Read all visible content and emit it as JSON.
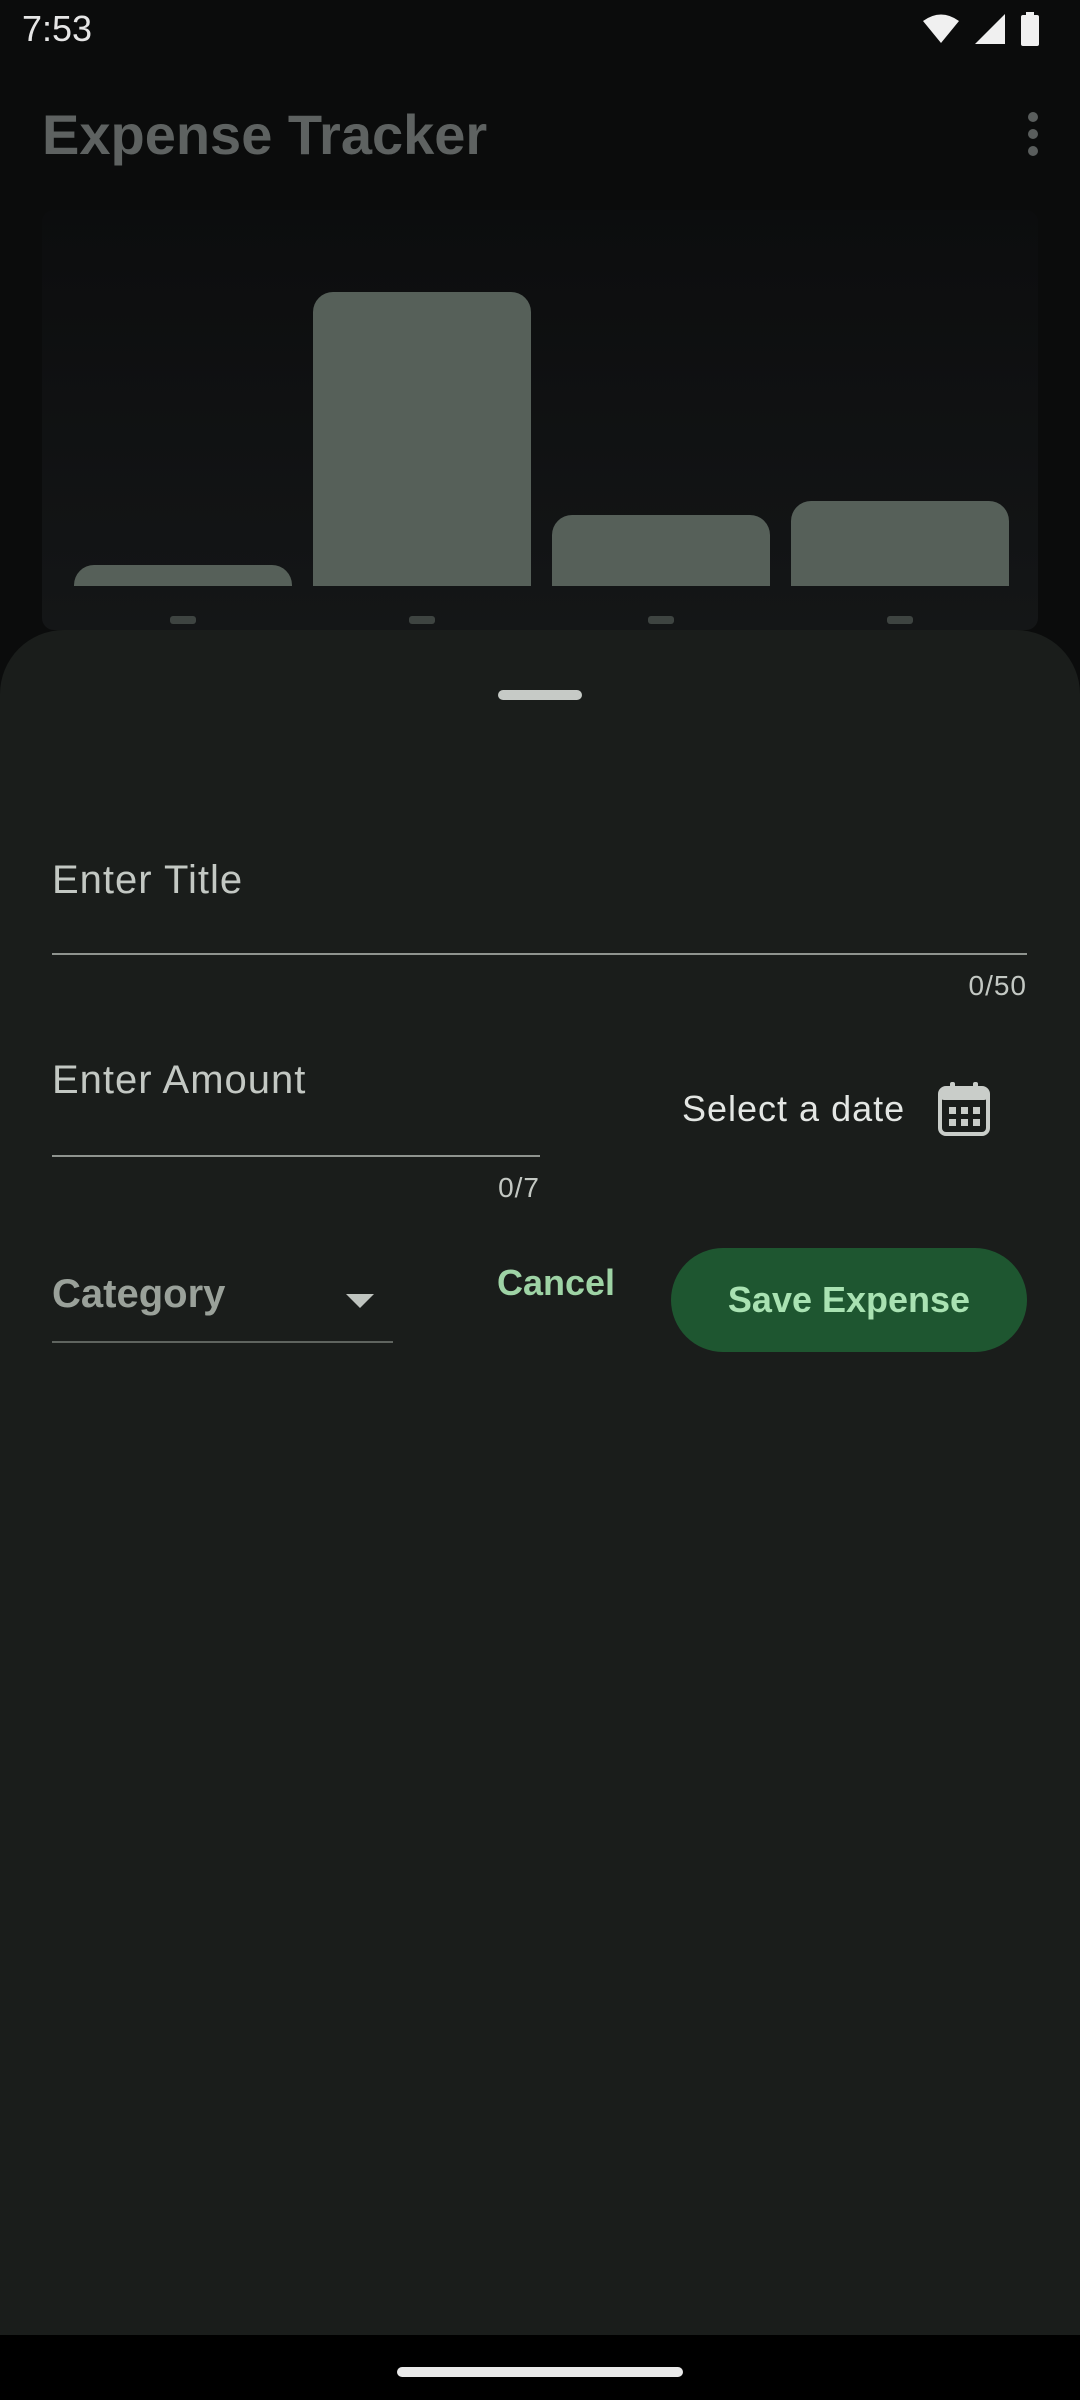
{
  "status_bar": {
    "time": "7:53"
  },
  "app": {
    "title": "Expense Tracker"
  },
  "chart_data": {
    "type": "bar",
    "values": [
      0.07,
      1.0,
      0.24,
      0.29
    ]
  },
  "sheet": {
    "title_field": {
      "placeholder": "Enter Title",
      "counter": "0/50"
    },
    "amount_field": {
      "placeholder": "Enter Amount",
      "counter": "0/7"
    },
    "date": {
      "label": "Select a date"
    },
    "category": {
      "label": "Category"
    },
    "cancel_label": "Cancel",
    "save_label": "Save Expense"
  },
  "colors": {
    "sheet_bg": "#1a1d1b",
    "accent_text": "#9ed3a5",
    "save_button_bg": "#1e5630"
  }
}
